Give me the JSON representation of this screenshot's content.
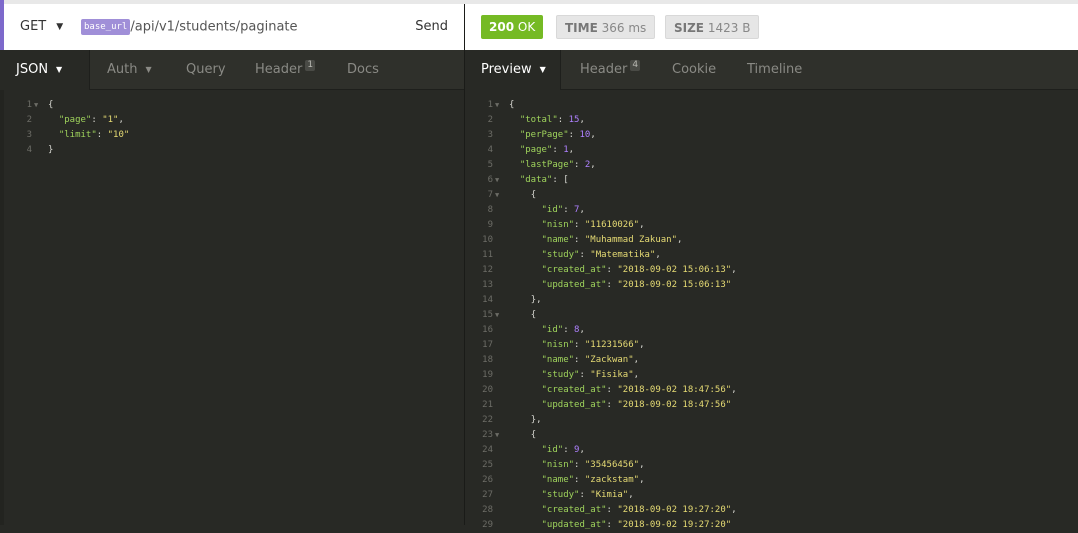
{
  "request": {
    "method": "GET",
    "base_url_tag": "base_url",
    "path": "/api/v1/students/paginate",
    "send_label": "Send"
  },
  "request_tabs": [
    {
      "label": "JSON",
      "active": true,
      "caret": true
    },
    {
      "label": "Auth",
      "caret": true
    },
    {
      "label": "Query"
    },
    {
      "label": "Header",
      "badge": "1"
    },
    {
      "label": "Docs"
    }
  ],
  "request_body": [
    {
      "n": "1",
      "fold": true,
      "code": "{"
    },
    {
      "n": "2",
      "code": "  \"page\": \"1\","
    },
    {
      "n": "3",
      "code": "  \"limit\": \"10\""
    },
    {
      "n": "4",
      "code": "}"
    }
  ],
  "response": {
    "status_code": "200",
    "status_text": "OK",
    "time_label": "TIME",
    "time_value": "366 ms",
    "size_label": "SIZE",
    "size_value": "1423 B"
  },
  "response_tabs": [
    {
      "label": "Preview",
      "active": true,
      "caret": true
    },
    {
      "label": "Header",
      "badge": "4"
    },
    {
      "label": "Cookie"
    },
    {
      "label": "Timeline"
    }
  ],
  "response_body": [
    {
      "n": "1",
      "fold": true,
      "code": "{"
    },
    {
      "n": "2",
      "code": "  \"total\": 15,"
    },
    {
      "n": "3",
      "code": "  \"perPage\": 10,"
    },
    {
      "n": "4",
      "code": "  \"page\": 1,"
    },
    {
      "n": "5",
      "code": "  \"lastPage\": 2,"
    },
    {
      "n": "6",
      "fold": true,
      "code": "  \"data\": ["
    },
    {
      "n": "7",
      "fold": true,
      "code": "    {"
    },
    {
      "n": "8",
      "code": "      \"id\": 7,"
    },
    {
      "n": "9",
      "code": "      \"nisn\": \"11610026\","
    },
    {
      "n": "10",
      "code": "      \"name\": \"Muhammad Zakuan\","
    },
    {
      "n": "11",
      "code": "      \"study\": \"Matematika\","
    },
    {
      "n": "12",
      "code": "      \"created_at\": \"2018-09-02 15:06:13\","
    },
    {
      "n": "13",
      "code": "      \"updated_at\": \"2018-09-02 15:06:13\""
    },
    {
      "n": "14",
      "code": "    },"
    },
    {
      "n": "15",
      "fold": true,
      "code": "    {"
    },
    {
      "n": "16",
      "code": "      \"id\": 8,"
    },
    {
      "n": "17",
      "code": "      \"nisn\": \"11231566\","
    },
    {
      "n": "18",
      "code": "      \"name\": \"Zackwan\","
    },
    {
      "n": "19",
      "code": "      \"study\": \"Fisika\","
    },
    {
      "n": "20",
      "code": "      \"created_at\": \"2018-09-02 18:47:56\","
    },
    {
      "n": "21",
      "code": "      \"updated_at\": \"2018-09-02 18:47:56\""
    },
    {
      "n": "22",
      "code": "    },"
    },
    {
      "n": "23",
      "fold": true,
      "code": "    {"
    },
    {
      "n": "24",
      "code": "      \"id\": 9,"
    },
    {
      "n": "25",
      "code": "      \"nisn\": \"35456456\","
    },
    {
      "n": "26",
      "code": "      \"name\": \"zackstam\","
    },
    {
      "n": "27",
      "code": "      \"study\": \"Kimia\","
    },
    {
      "n": "28",
      "code": "      \"created_at\": \"2018-09-02 19:27:20\","
    },
    {
      "n": "29",
      "code": "      \"updated_at\": \"2018-09-02 19:27:20\""
    }
  ],
  "colors": {
    "accent": "#7d69cb",
    "status_ok": "#75ba24",
    "editor_bg": "#282925",
    "json_key": "#9fd35c",
    "json_string": "#e6db74",
    "json_number": "#ae81ff"
  }
}
